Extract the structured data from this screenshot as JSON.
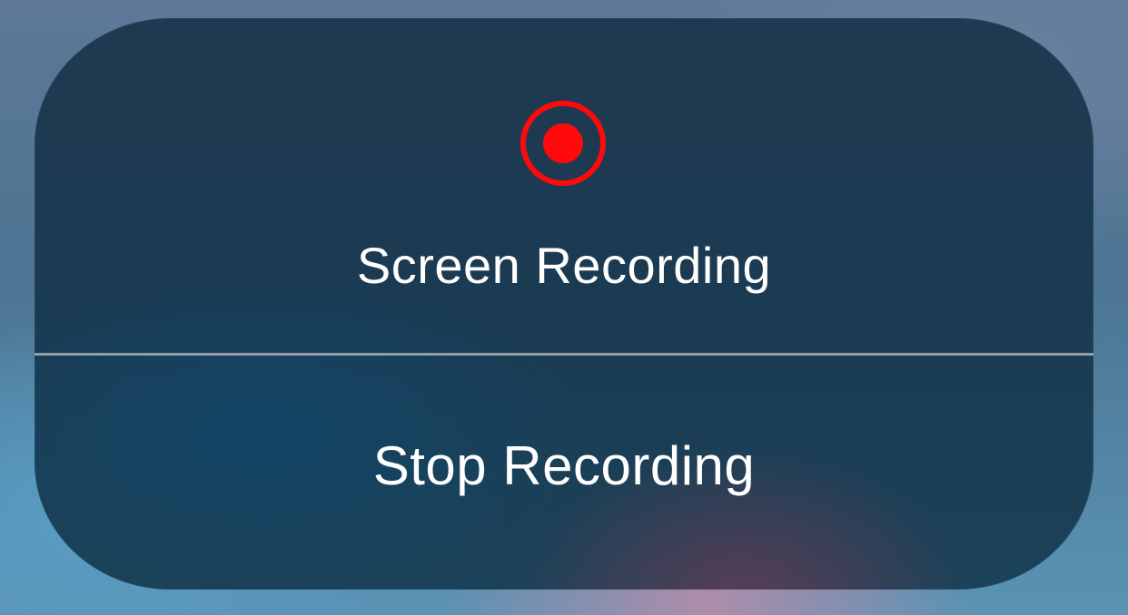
{
  "menu": {
    "title": "Screen Recording",
    "icon": "record-icon",
    "action_label": "Stop Recording"
  },
  "colors": {
    "record_red": "#ff0a0a",
    "text": "#ffffff",
    "panel": "#1d3c53"
  }
}
